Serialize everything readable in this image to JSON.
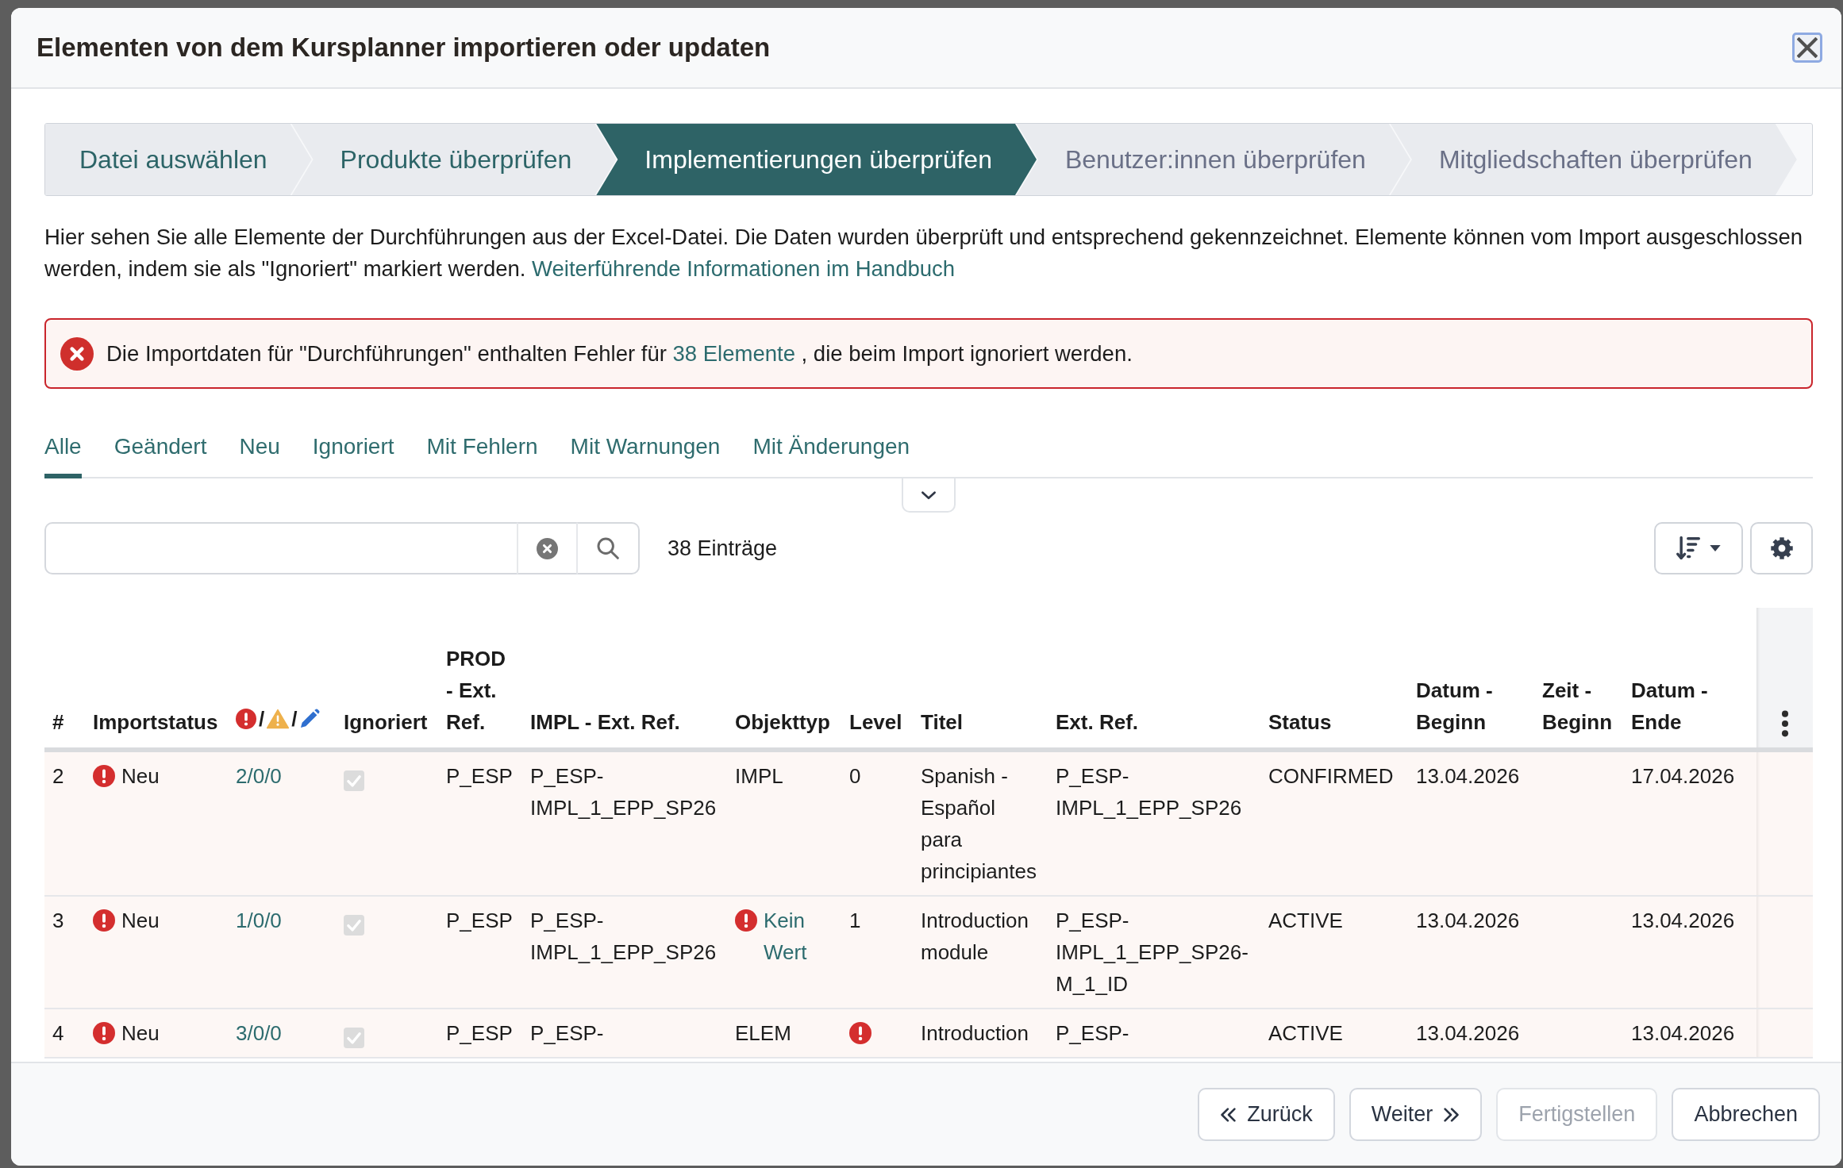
{
  "dialog": {
    "title": "Elementen von dem Kursplanner importieren oder updaten",
    "close_focused": true
  },
  "wizard_steps": [
    {
      "label": "Datei auswählen",
      "completed": true,
      "selected": false
    },
    {
      "label": "Produkte überprüfen",
      "completed": true,
      "selected": false
    },
    {
      "label": "Implementierungen überprüfen",
      "completed": false,
      "selected": true
    },
    {
      "label": "Benutzer:innen überprüfen",
      "completed": false,
      "selected": false
    },
    {
      "label": "Mitgliedschaften überprüfen",
      "completed": false,
      "selected": false
    }
  ],
  "description": {
    "text": "Hier sehen Sie alle Elemente der Durchführungen aus der Excel-Datei. Die Daten wurden überprüft und entsprechend gekennzeichnet. Elemente können vom Import ausgeschlossen werden, indem sie als \"Ignoriert\" markiert werden.",
    "link": "Weiterführende Informationen im Handbuch"
  },
  "alert": {
    "kind": "error",
    "text": "Die Importdaten für \"Durchführungen\" enthalten Fehler für",
    "link": "38 Elemente",
    "text_after": ", die beim Import ignoriert werden."
  },
  "filter_tabs": [
    {
      "label": "Alle",
      "selected": true
    },
    {
      "label": "Geändert",
      "selected": false
    },
    {
      "label": "Neu",
      "selected": false
    },
    {
      "label": "Ignoriert",
      "selected": false
    },
    {
      "label": "Mit Fehlern",
      "selected": false
    },
    {
      "label": "Mit Warnungen",
      "selected": false
    },
    {
      "label": "Mit Änderungen",
      "selected": false
    }
  ],
  "filter_panel": {
    "expanded": false
  },
  "entry_count": "38 Einträge",
  "table": {
    "columns": [
      {
        "kind": "text",
        "label": "#"
      },
      {
        "kind": "text",
        "label": "Importstatus"
      },
      {
        "kind": "status_icons",
        "separators": [
          "/",
          "/"
        ]
      },
      {
        "kind": "text",
        "label": "Ignoriert"
      },
      {
        "kind": "text",
        "label": "PROD - Ext. Ref."
      },
      {
        "kind": "text",
        "label": "IMPL - Ext. Ref."
      },
      {
        "kind": "text",
        "label": "Objekttyp"
      },
      {
        "kind": "text",
        "label": "Level"
      },
      {
        "kind": "text",
        "label": "Titel"
      },
      {
        "kind": "text",
        "label": "Ext. Ref."
      },
      {
        "kind": "text",
        "label": "Status"
      },
      {
        "kind": "text",
        "label": "Datum - Beginn"
      },
      {
        "kind": "text",
        "label": "Zeit - Beginn"
      },
      {
        "kind": "text",
        "label": "Datum - Ende"
      },
      {
        "kind": "menu"
      }
    ],
    "rows": [
      {
        "number": "2",
        "import_status": {
          "label": "Neu",
          "error": true
        },
        "counts": "2/0/0",
        "ignored": {
          "checked": true,
          "disabled": true
        },
        "prod_ext_ref": "P_ESP",
        "impl_ext_ref": "P_ESP-IMPL_1_EPP_SP26",
        "object_type": {
          "text": "IMPL",
          "error": false
        },
        "level": {
          "text": "0",
          "error": false
        },
        "title": "Spanish - Español para principiantes",
        "ext_ref": "P_ESP-IMPL_1_EPP_SP26",
        "status": "CONFIRMED",
        "start_date": "13.04.2026",
        "end_date": "17.04.2026"
      },
      {
        "number": "3",
        "import_status": {
          "label": "Neu",
          "error": true
        },
        "counts": "1/0/0",
        "ignored": {
          "checked": true,
          "disabled": true
        },
        "prod_ext_ref": "P_ESP",
        "impl_ext_ref": "P_ESP-IMPL_1_EPP_SP26",
        "object_type": {
          "text": "Kein Wert",
          "error": true
        },
        "level": {
          "text": "1",
          "error": false
        },
        "title": "Introduction module",
        "ext_ref": "P_ESP-IMPL_1_EPP_SP26-M_1_ID",
        "status": "ACTIVE",
        "start_date": "13.04.2026",
        "end_date": "13.04.2026"
      },
      {
        "number": "4",
        "import_status": {
          "label": "Neu",
          "error": true
        },
        "counts": "3/0/0",
        "ignored": {
          "checked": true,
          "disabled": true
        },
        "prod_ext_ref": "P_ESP",
        "impl_ext_ref": "P_ESP-",
        "object_type": {
          "text": "ELEM",
          "error": false
        },
        "level": {
          "error": true
        },
        "title": "Introduction",
        "ext_ref": "P_ESP-",
        "status": "ACTIVE",
        "start_date": "13.04.2026",
        "end_date": "13.04.2026"
      }
    ]
  },
  "footer_buttons": [
    {
      "label": "Zurück",
      "kind": "back",
      "disabled": false
    },
    {
      "label": "Weiter",
      "kind": "next",
      "disabled": false
    },
    {
      "label": "Fertigstellen",
      "kind": "plain",
      "disabled": true
    },
    {
      "label": "Abbrechen",
      "kind": "plain",
      "disabled": false
    }
  ]
}
